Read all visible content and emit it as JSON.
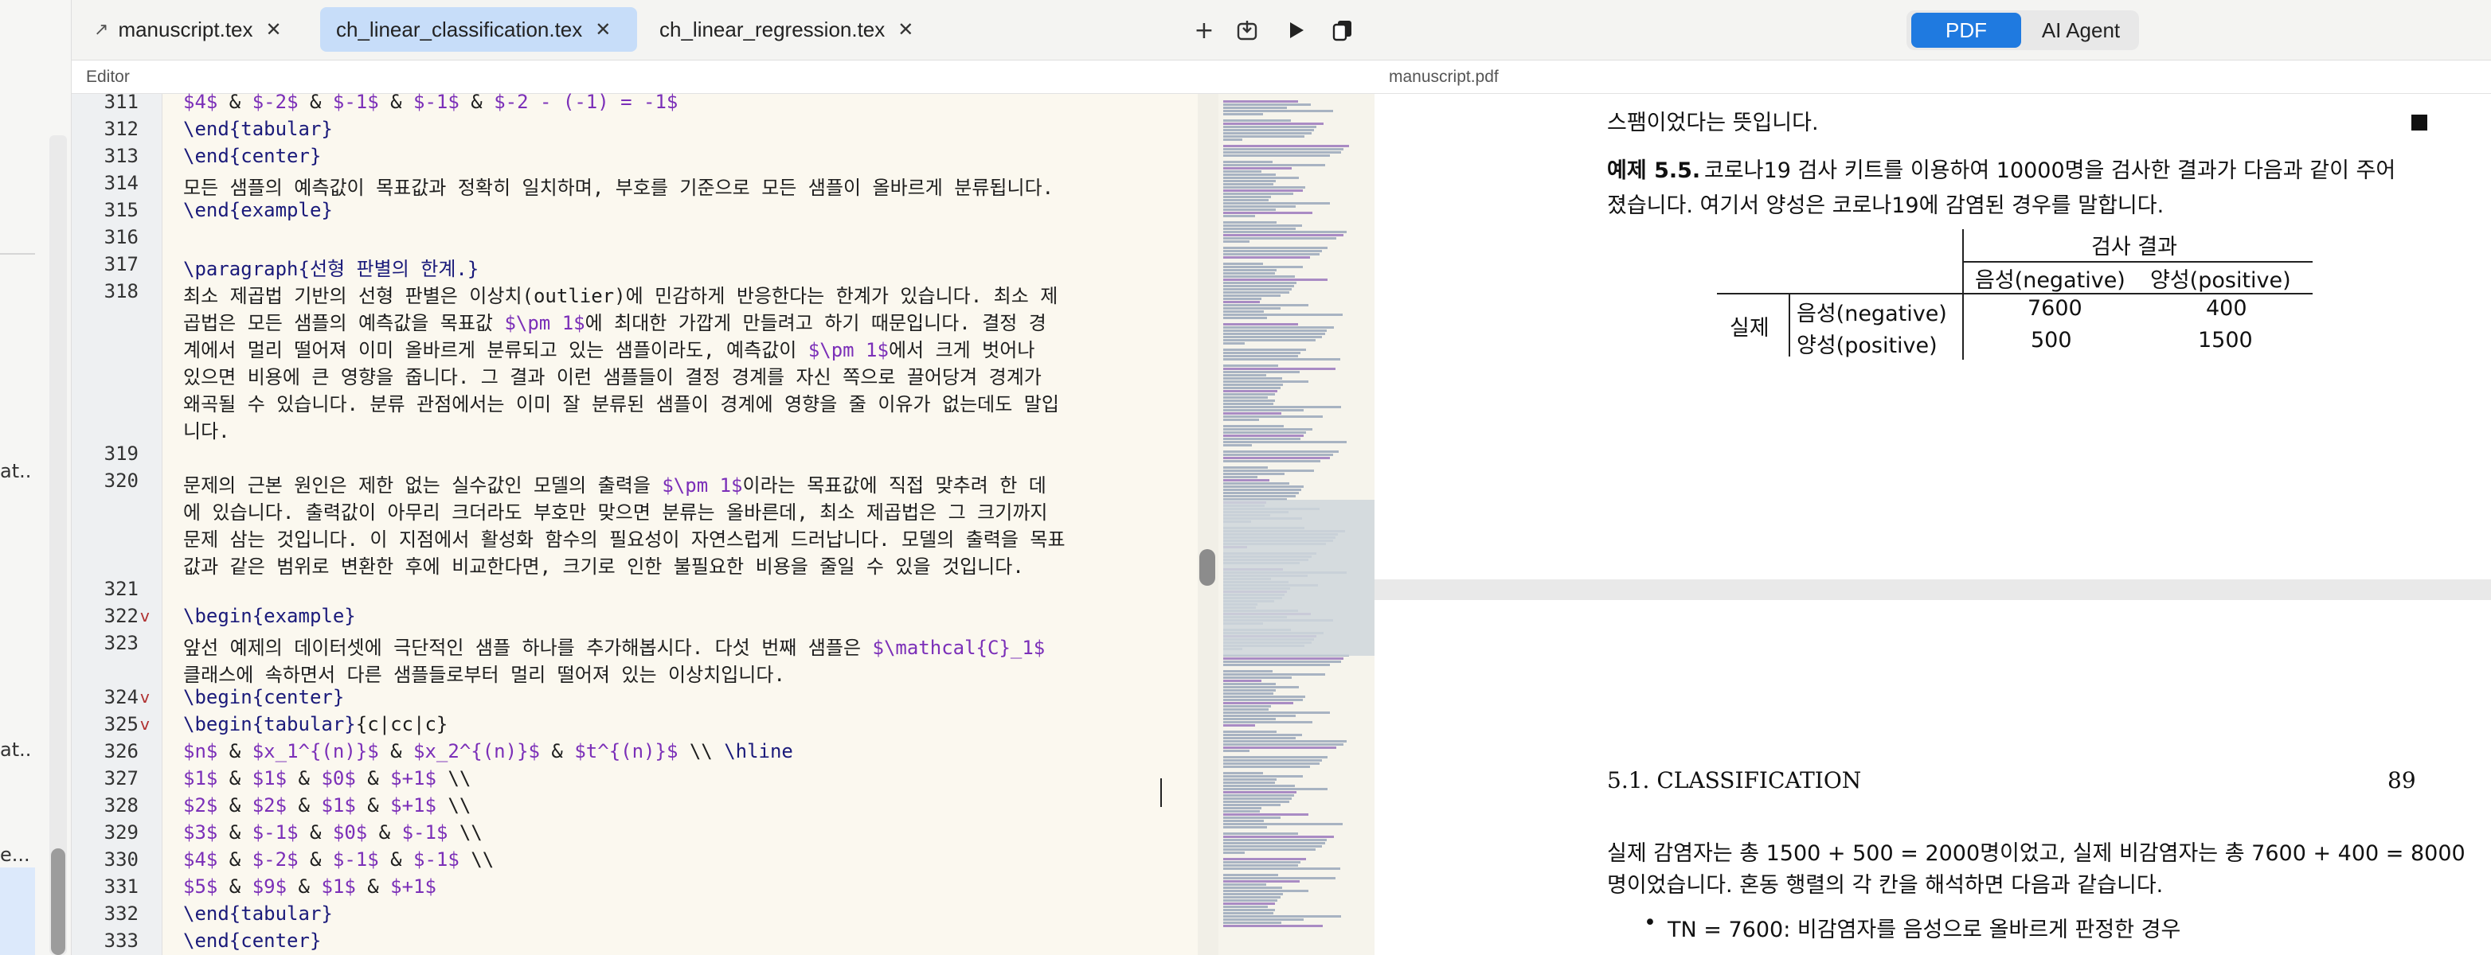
{
  "sidebar": {
    "items": [
      "at...",
      "at...",
      "e..."
    ]
  },
  "tabs": [
    {
      "label": "manuscript.tex",
      "active": false
    },
    {
      "label": "ch_linear_classification.tex",
      "active": true
    },
    {
      "label": "ch_linear_regression.tex",
      "active": false
    }
  ],
  "toolbar_icons": [
    "plus-icon",
    "download-icon",
    "play-icon",
    "copy-icon"
  ],
  "editor": {
    "label": "Editor",
    "lines": [
      {
        "n": "311",
        "t": "$4$ & $-2$ & $-1$ & $-1$ & $-2 - (-1) = -1$"
      },
      {
        "n": "312",
        "t": "\\end{tabular}"
      },
      {
        "n": "313",
        "t": "\\end{center}"
      },
      {
        "n": "314",
        "t": "모든 샘플의 예측값이 목표값과 정확히 일치하며, 부호를 기준으로 모든 샘플이 올바르게 분류됩니다."
      },
      {
        "n": "315",
        "t": "\\end{example}"
      },
      {
        "n": "316",
        "t": ""
      },
      {
        "n": "317",
        "t": "\\paragraph{선형 판별의 한계.}"
      },
      {
        "n": "318",
        "t": "최소 제곱법 기반의 선형 판별은 이상치(outlier)에 민감하게 반응한다는 한계가 있습니다. 최소 제"
      },
      {
        "n": "",
        "t": "곱법은 모든 샘플의 예측값을 목표값 $\\pm 1$에 최대한 가깝게 만들려고 하기 때문입니다. 결정 경"
      },
      {
        "n": "",
        "t": "계에서 멀리 떨어져 이미 올바르게 분류되고 있는 샘플이라도, 예측값이 $\\pm 1$에서 크게 벗어나"
      },
      {
        "n": "",
        "t": "있으면 비용에 큰 영향을 줍니다. 그 결과 이런 샘플들이 결정 경계를 자신 쪽으로 끌어당겨 경계가"
      },
      {
        "n": "",
        "t": "왜곡될 수 있습니다. 분류 관점에서는 이미 잘 분류된 샘플이 경계에 영향을 줄 이유가 없는데도 말입"
      },
      {
        "n": "",
        "t": "니다."
      },
      {
        "n": "319",
        "t": ""
      },
      {
        "n": "320",
        "t": "문제의 근본 원인은 제한 없는 실수값인 모델의 출력을 $\\pm 1$이라는 목표값에 직접 맞추려 한 데"
      },
      {
        "n": "",
        "t": "에 있습니다. 출력값이 아무리 크더라도 부호만 맞으면 분류는 올바른데, 최소 제곱법은 그 크기까지"
      },
      {
        "n": "",
        "t": "문제 삼는 것입니다. 이 지점에서 활성화 함수의 필요성이 자연스럽게 드러납니다. 모델의 출력을 목표"
      },
      {
        "n": "",
        "t": "값과 같은 범위로 변환한 후에 비교한다면, 크기로 인한 불필요한 비용을 줄일 수 있을 것입니다."
      },
      {
        "n": "321",
        "t": ""
      },
      {
        "n": "322",
        "t": "\\begin{example}",
        "fold": true
      },
      {
        "n": "323",
        "t": "앞선 예제의 데이터셋에 극단적인 샘플 하나를 추가해봅시다. 다섯 번째 샘플은 $\\mathcal{C}_1$"
      },
      {
        "n": "",
        "t": "클래스에 속하면서 다른 샘플들로부터 멀리 떨어져 있는 이상치입니다."
      },
      {
        "n": "324",
        "t": "\\begin{center}",
        "fold": true
      },
      {
        "n": "325",
        "t": "\\begin{tabular}{c|cc|c}",
        "fold": true
      },
      {
        "n": "326",
        "t": "$n$ & $x_1^{(n)}$ & $x_2^{(n)}$ & $t^{(n)}$ \\\\ \\hline"
      },
      {
        "n": "327",
        "t": "$1$ & $1$ & $0$ & $+1$ \\\\"
      },
      {
        "n": "328",
        "t": "$2$ & $2$ & $1$ & $+1$ \\\\"
      },
      {
        "n": "329",
        "t": "$3$ & $-1$ & $0$ & $-1$ \\\\"
      },
      {
        "n": "330",
        "t": "$4$ & $-2$ & $-1$ & $-1$ \\\\"
      },
      {
        "n": "331",
        "t": "$5$ & $9$ & $1$ & $+1$"
      },
      {
        "n": "332",
        "t": "\\end{tabular}"
      },
      {
        "n": "333",
        "t": "\\end{center}"
      }
    ]
  },
  "viewer": {
    "modes": {
      "pdf": "PDF",
      "agent": "AI Agent"
    },
    "label": "manuscript.pdf",
    "page1": {
      "line_a": "스팸이었다는 뜻입니다.",
      "example_head": "예제 5.5.",
      "example_text1": "코로나19 검사 키트를 이용하여 10000명을 검사한 결과가 다음과 같이 주어",
      "example_text2": "졌습니다. 여기서 양성은 코로나19에 감염된 경우를 말합니다.",
      "table": {
        "group_header": "검사 결과",
        "col_neg": "음성(negative)",
        "col_pos": "양성(positive)",
        "row_group": "실제",
        "rows": [
          {
            "label": "음성(negative)",
            "neg": "7600",
            "pos": "400"
          },
          {
            "label": "양성(positive)",
            "neg": "500",
            "pos": "1500"
          }
        ]
      }
    },
    "page2": {
      "section": "5.1.  CLASSIFICATION",
      "page_number": "89",
      "line1": "실제 감염자는 총 1500 + 500 = 2000명이었고, 실제 비감염자는 총 7600 + 400 = 8000",
      "line2": "명이었습니다. 혼동 행렬의 각 칸을 해석하면 다음과 같습니다.",
      "bullet1": "TN = 7600: 비감염자를 음성으로 올바르게 판정한 경우"
    }
  }
}
